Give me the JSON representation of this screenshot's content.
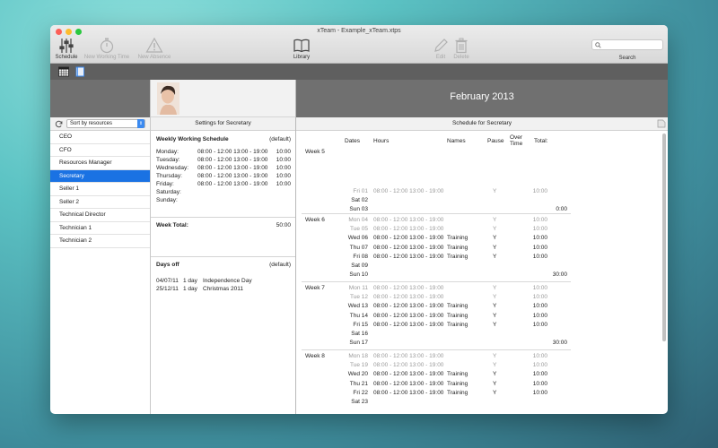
{
  "window": {
    "title": "xTeam - Example_xTeam.xtps"
  },
  "toolbar": {
    "schedule": "Schedule",
    "new_working_time": "New Working Time",
    "new_absence": "New Absence",
    "library": "Library",
    "edit": "Edit",
    "delete": "Delete",
    "search_label": "Search",
    "search_placeholder": ""
  },
  "sidebar": {
    "sort_by": "Sort by resources",
    "items": [
      {
        "label": "CEO",
        "selected": false
      },
      {
        "label": "CFO",
        "selected": false
      },
      {
        "label": "Resources Manager",
        "selected": false
      },
      {
        "label": "Secretary",
        "selected": true
      },
      {
        "label": "Seller 1",
        "selected": false
      },
      {
        "label": "Seller 2",
        "selected": false
      },
      {
        "label": "Technical Director",
        "selected": false
      },
      {
        "label": "Technician 1",
        "selected": false
      },
      {
        "label": "Technician 2",
        "selected": false
      }
    ]
  },
  "settings": {
    "title": "Settings for Secretary",
    "weekly_title": "Weekly Working Schedule",
    "weekly_default": "(default)",
    "days": [
      {
        "day": "Monday:",
        "hours": "08:00 - 12:00 13:00 - 19:00",
        "total": "10:00"
      },
      {
        "day": "Tuesday:",
        "hours": "08:00 - 12:00 13:00 - 19:00",
        "total": "10:00"
      },
      {
        "day": "Wednesday:",
        "hours": "08:00 - 12:00 13:00 - 19:00",
        "total": "10:00"
      },
      {
        "day": "Thursday:",
        "hours": "08:00 - 12:00 13:00 - 19:00",
        "total": "10:00"
      },
      {
        "day": "Friday:",
        "hours": "08:00 - 12:00 13:00 - 19:00",
        "total": "10:00"
      },
      {
        "day": "Saturday:",
        "hours": "",
        "total": ""
      },
      {
        "day": "Sunday:",
        "hours": "",
        "total": ""
      }
    ],
    "week_total_label": "Week Total:",
    "week_total": "50:00",
    "days_off_title": "Days off",
    "days_off_default": "(default)",
    "days_off": [
      {
        "date": "04/07/11",
        "length": "1 day",
        "name": "Independence Day"
      },
      {
        "date": "25/12/11",
        "length": "1 day",
        "name": "Christmas 2011"
      }
    ]
  },
  "schedule": {
    "month": "February 2013",
    "title": "Schedule for Secretary",
    "columns": {
      "dates": "Dates",
      "hours": "Hours",
      "names": "Names",
      "pause": "Pause",
      "overtime": "Over Time",
      "total": "Total:"
    },
    "weeks": [
      {
        "label": "Week 5",
        "total": "0:00",
        "rows": [
          {
            "date": "Fri 01",
            "hours": "08:00 - 12:00 13:00 - 19:00",
            "name": "",
            "pause": "Y",
            "total": "10:00",
            "dim": true
          },
          {
            "date": "Sat 02",
            "hours": "",
            "name": "",
            "pause": "",
            "total": "",
            "dim": false
          },
          {
            "date": "Sun 03",
            "hours": "",
            "name": "",
            "pause": "",
            "total": "",
            "dim": false
          }
        ]
      },
      {
        "label": "Week 6",
        "total": "30:00",
        "rows": [
          {
            "date": "Mon 04",
            "hours": "08:00 - 12:00 13:00 - 19:00",
            "name": "",
            "pause": "Y",
            "total": "10:00",
            "dim": true
          },
          {
            "date": "Tue 05",
            "hours": "08:00 - 12:00 13:00 - 19:00",
            "name": "",
            "pause": "Y",
            "total": "10:00",
            "dim": true
          },
          {
            "date": "Wed 06",
            "hours": "08:00 - 12:00 13:00 - 19:00",
            "name": "Training",
            "pause": "Y",
            "total": "10:00",
            "dim": false
          },
          {
            "date": "Thu 07",
            "hours": "08:00 - 12:00 13:00 - 19:00",
            "name": "Training",
            "pause": "Y",
            "total": "10:00",
            "dim": false
          },
          {
            "date": "Fri 08",
            "hours": "08:00 - 12:00 13:00 - 19:00",
            "name": "Training",
            "pause": "Y",
            "total": "10:00",
            "dim": false
          },
          {
            "date": "Sat 09",
            "hours": "",
            "name": "",
            "pause": "",
            "total": "",
            "dim": false
          },
          {
            "date": "Sun 10",
            "hours": "",
            "name": "",
            "pause": "",
            "total": "",
            "dim": false
          }
        ]
      },
      {
        "label": "Week 7",
        "total": "30:00",
        "rows": [
          {
            "date": "Mon 11",
            "hours": "08:00 - 12:00 13:00 - 19:00",
            "name": "",
            "pause": "Y",
            "total": "10:00",
            "dim": true
          },
          {
            "date": "Tue 12",
            "hours": "08:00 - 12:00 13:00 - 19:00",
            "name": "",
            "pause": "Y",
            "total": "10:00",
            "dim": true
          },
          {
            "date": "Wed 13",
            "hours": "08:00 - 12:00 13:00 - 19:00",
            "name": "Training",
            "pause": "Y",
            "total": "10:00",
            "dim": false
          },
          {
            "date": "Thu 14",
            "hours": "08:00 - 12:00 13:00 - 19:00",
            "name": "Training",
            "pause": "Y",
            "total": "10:00",
            "dim": false
          },
          {
            "date": "Fri 15",
            "hours": "08:00 - 12:00 13:00 - 19:00",
            "name": "Training",
            "pause": "Y",
            "total": "10:00",
            "dim": false
          },
          {
            "date": "Sat 16",
            "hours": "",
            "name": "",
            "pause": "",
            "total": "",
            "dim": false
          },
          {
            "date": "Sun 17",
            "hours": "",
            "name": "",
            "pause": "",
            "total": "",
            "dim": false
          }
        ]
      },
      {
        "label": "Week 8",
        "total": "",
        "rows": [
          {
            "date": "Mon 18",
            "hours": "08:00 - 12:00 13:00 - 19:00",
            "name": "",
            "pause": "Y",
            "total": "10:00",
            "dim": true
          },
          {
            "date": "Tue 19",
            "hours": "08:00 - 12:00 13:00 - 19:00",
            "name": "",
            "pause": "Y",
            "total": "10:00",
            "dim": true
          },
          {
            "date": "Wed 20",
            "hours": "08:00 - 12:00 13:00 - 19:00",
            "name": "Training",
            "pause": "Y",
            "total": "10:00",
            "dim": false
          },
          {
            "date": "Thu 21",
            "hours": "08:00 - 12:00 13:00 - 19:00",
            "name": "Training",
            "pause": "Y",
            "total": "10:00",
            "dim": false
          },
          {
            "date": "Fri 22",
            "hours": "08:00 - 12:00 13:00 - 19:00",
            "name": "Training",
            "pause": "Y",
            "total": "10:00",
            "dim": false
          },
          {
            "date": "Sat 23",
            "hours": "",
            "name": "",
            "pause": "",
            "total": "",
            "dim": false
          }
        ]
      }
    ]
  },
  "colors": {
    "accent": "#1a72e3",
    "header_gray": "#707070",
    "toolbar_dark": "#5f5f5f"
  },
  "icons": {
    "schedule": "sliders-icon",
    "new_working_time": "stopwatch-icon",
    "new_absence": "warning-triangle-icon",
    "library": "book-icon",
    "edit": "pencil-icon",
    "delete": "trash-icon",
    "search": "search-icon",
    "view_calendar": "calendar-grid-icon",
    "view_list": "notebook-icon",
    "refresh": "refresh-icon"
  }
}
